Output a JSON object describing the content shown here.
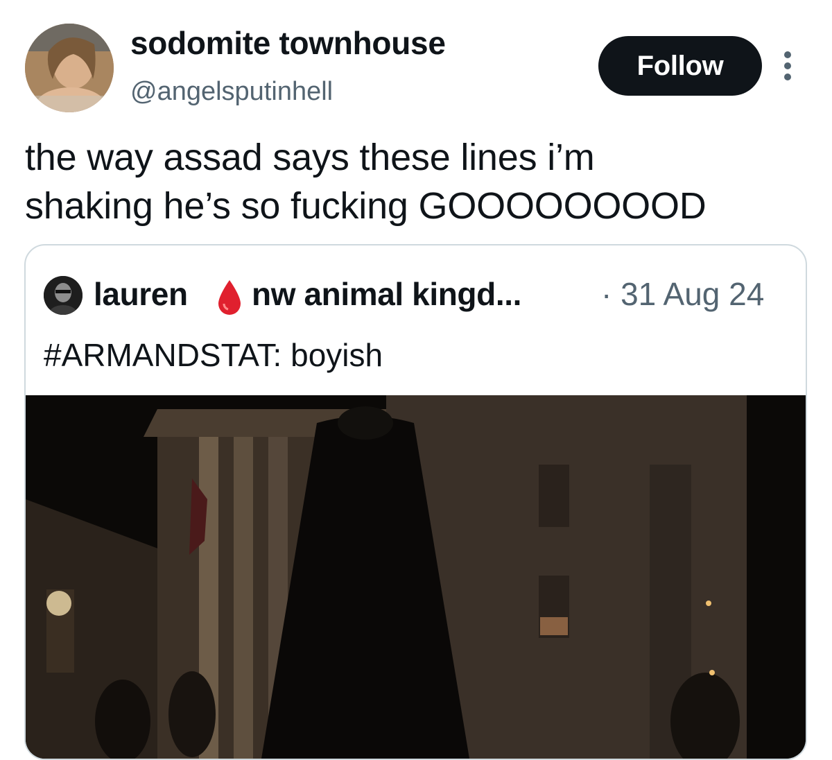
{
  "author": {
    "display_name": "sodomite townhouse",
    "handle": "@angelsputinhell"
  },
  "actions": {
    "follow_label": "Follow"
  },
  "tweet": {
    "lines": [
      "the way assad says these lines i’m",
      "shaking he’s so fucking GOOOOOOOOD"
    ]
  },
  "quoted_tweet": {
    "name_part1": "lauren",
    "name_part2": "nw animal kingd...",
    "date": "· 31 Aug 24",
    "text": "#ARMANDSTAT: boyish",
    "drop_icon": "blood-drop-icon"
  },
  "colors": {
    "text_primary": "#0f1419",
    "text_secondary": "#536471",
    "border": "#cfd9de",
    "follow_bg": "#0f1419",
    "drop": "#e0202e"
  }
}
